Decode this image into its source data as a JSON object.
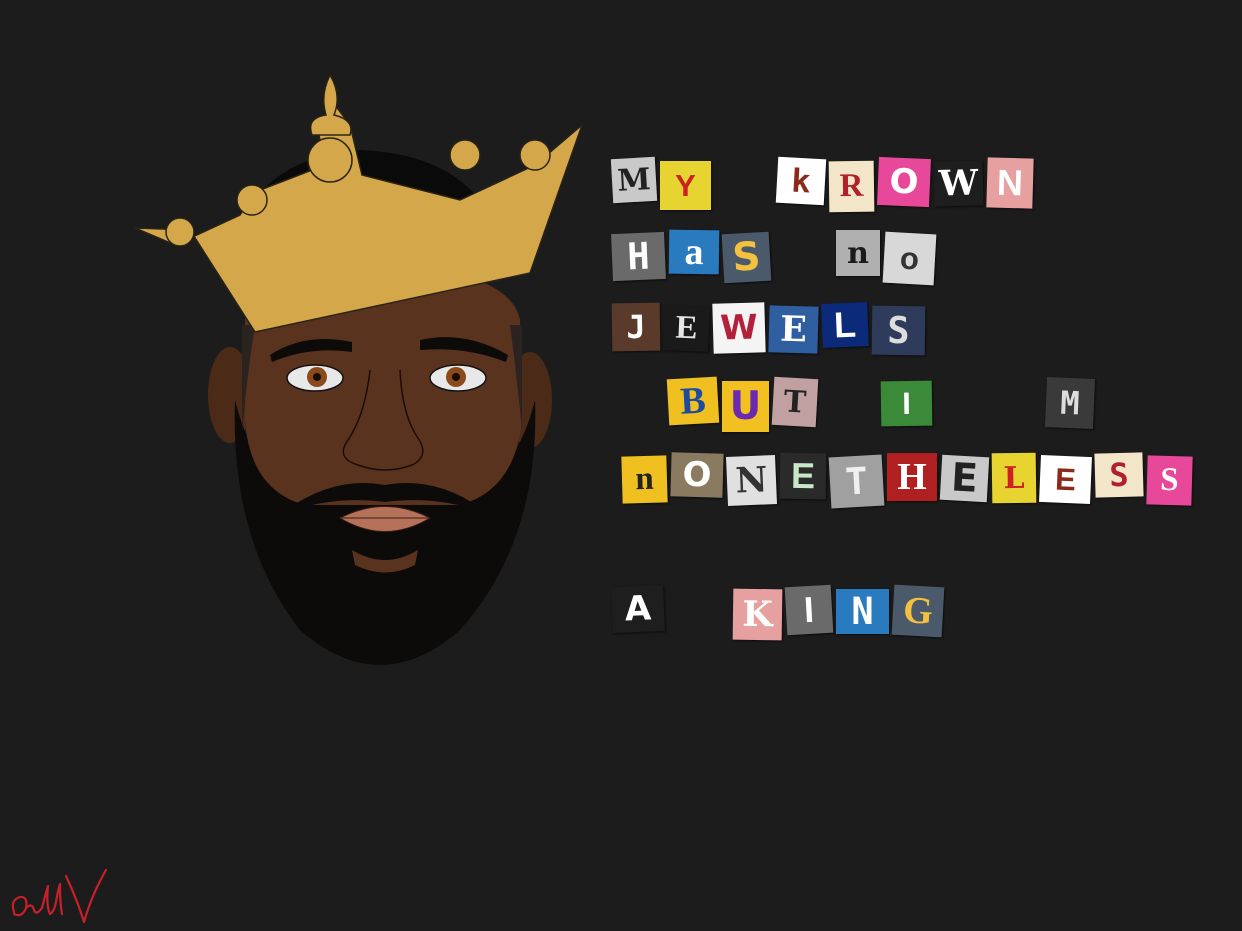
{
  "artwork": {
    "poem_lines": [
      {
        "word_groups": [
          [
            "M",
            "Y"
          ],
          [
            "k",
            "R",
            "O",
            "W",
            "N"
          ]
        ]
      },
      {
        "word_groups": [
          [
            "H",
            "a",
            "S"
          ],
          [
            "n",
            "o"
          ]
        ]
      },
      {
        "word_groups": [
          [
            "J",
            "E",
            "W",
            "E",
            "L",
            "S"
          ]
        ]
      },
      {
        "word_groups": [
          [
            "B",
            "U",
            "T"
          ],
          [
            "I"
          ],
          [
            "M"
          ]
        ]
      },
      {
        "word_groups": [
          [
            "n",
            "O",
            "N",
            "E",
            "T",
            "H",
            "E",
            "L",
            "E",
            "S",
            "S"
          ]
        ]
      },
      {
        "word_groups": [
          [
            "A"
          ],
          [
            "K",
            "I",
            "N",
            "G"
          ]
        ]
      }
    ],
    "signature_text": "Jell V",
    "colors": {
      "background": "#1c1c1c",
      "crown": "#d4a84a",
      "skin": "#5a331f",
      "beard": "#0d0b0a",
      "signature": "#c8202a"
    }
  }
}
